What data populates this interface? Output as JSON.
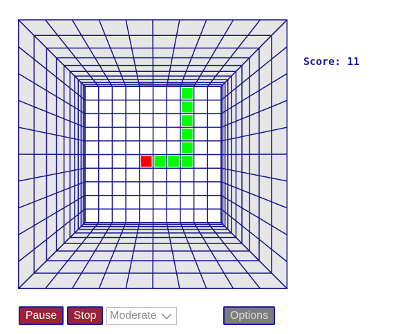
{
  "game": {
    "score_label": "Score:",
    "score_value": "11",
    "grid_color": "#14148c",
    "wall_color": "#e6e6e6",
    "snake_color": "#00ff00",
    "food_color": "#ff0000",
    "grid_cells": 10,
    "snake": {
      "back_wall": [
        [
          4,
          3
        ],
        [
          4,
          4
        ],
        [
          4,
          5
        ],
        [
          4,
          6
        ],
        [
          4,
          7
        ],
        [
          3,
          7
        ],
        [
          2,
          7
        ]
      ],
      "top_wall_rows_from_back": [
        [
          [
            4,
            0
          ],
          [
            5,
            0
          ],
          [
            6,
            0
          ]
        ],
        [
          [
            4,
            1
          ],
          [
            6,
            1
          ],
          [
            7,
            1
          ]
        ]
      ],
      "top_wall_extra": [
        [
          6,
          0
        ],
        [
          6,
          1
        ],
        [
          7,
          0
        ]
      ]
    },
    "food": [
      1,
      7
    ]
  },
  "controls": {
    "pause_label": "Pause",
    "stop_label": "Stop",
    "speed_value": "Moderate",
    "options_label": "Options"
  }
}
